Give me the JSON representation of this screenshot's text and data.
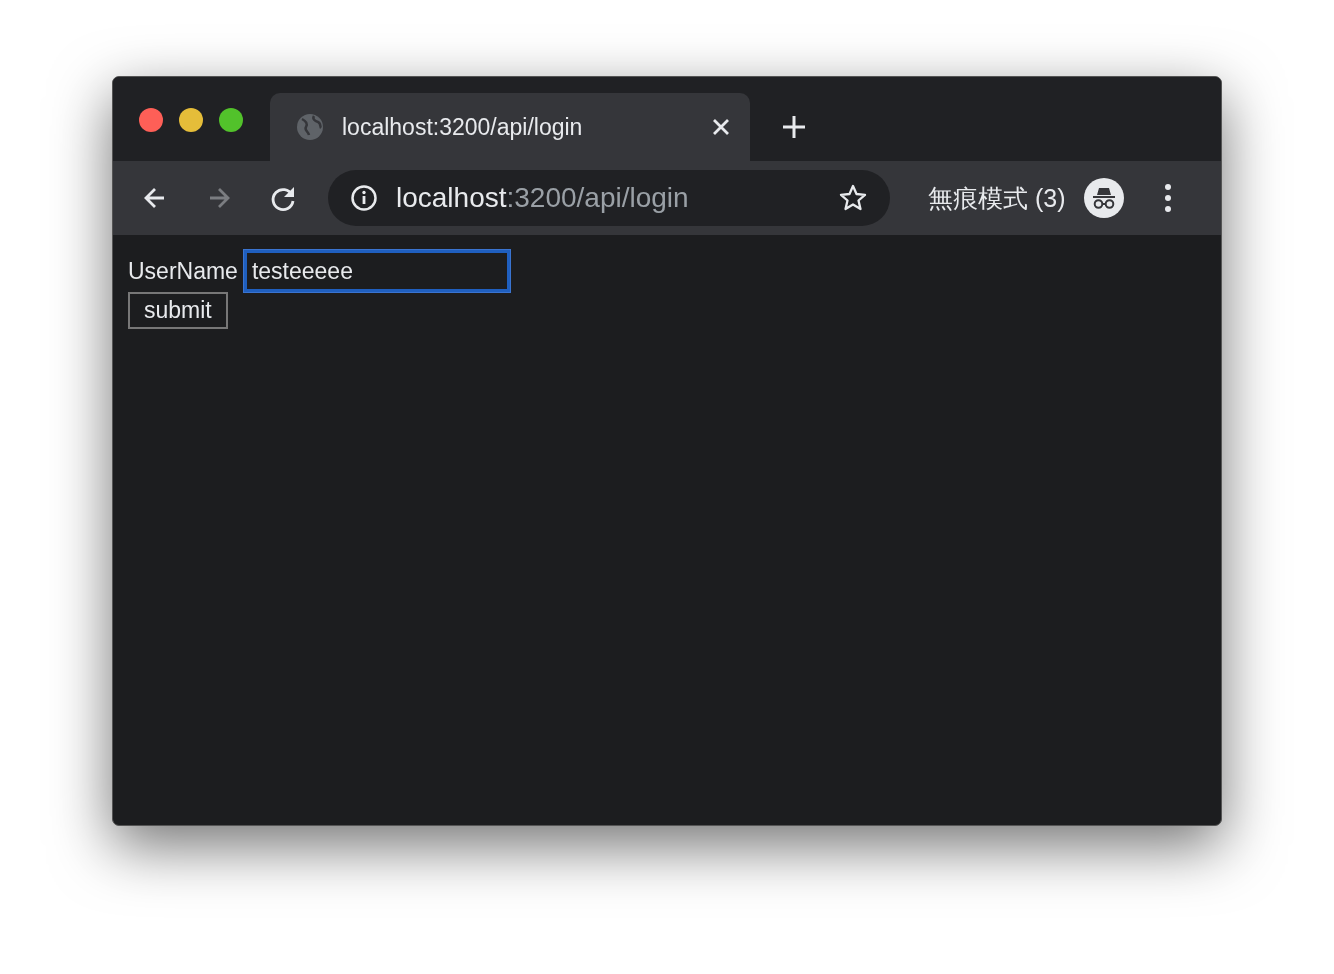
{
  "tabs": [
    {
      "title": "localhost:3200/api/login",
      "selected": true
    }
  ],
  "nav_buttons": [
    {
      "kind": "back",
      "disabled": false
    },
    {
      "kind": "forward",
      "disabled": true
    },
    {
      "kind": "reload",
      "disabled": false
    }
  ],
  "address_bar": {
    "host": "localhost",
    "path": ":3200/api/login"
  },
  "profile": {
    "label": "無痕模式 (3)"
  },
  "form": {
    "label": "UserName",
    "field": {
      "value": "testeeeee",
      "focused": true
    },
    "button": "submit"
  }
}
